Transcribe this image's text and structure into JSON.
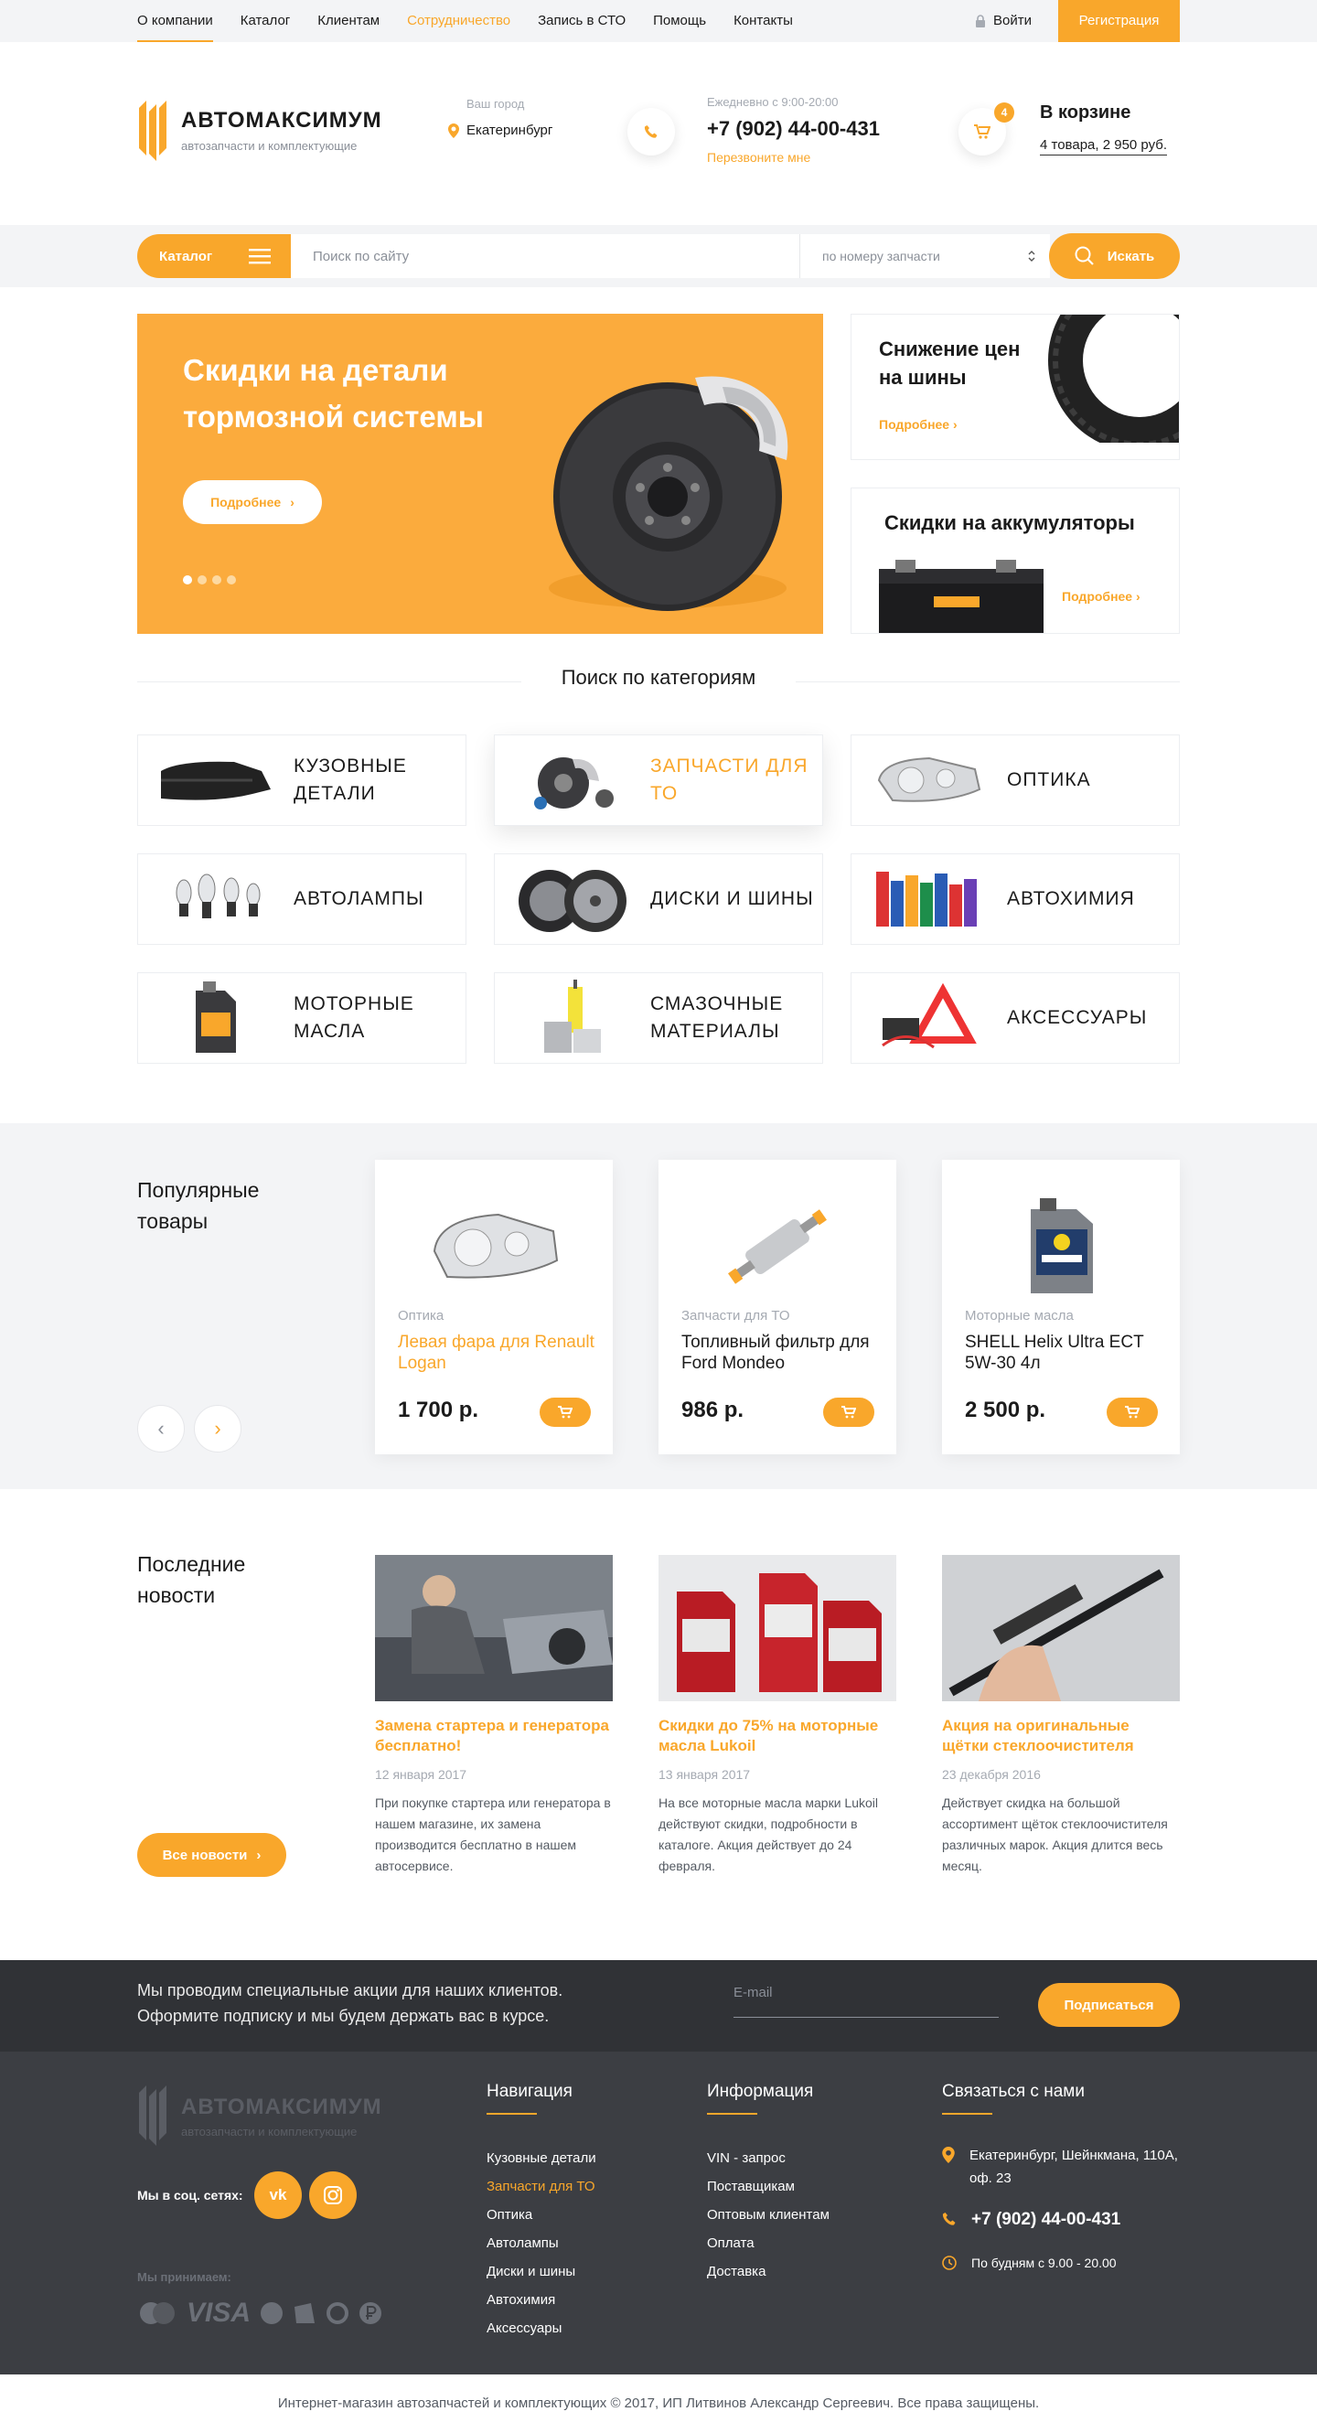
{
  "topnav": {
    "items": [
      "О компании",
      "Каталог",
      "Клиентам",
      "Сотрудничество",
      "Запись в СТО",
      "Помощь",
      "Контакты"
    ],
    "login": "Войти",
    "register": "Регистрация"
  },
  "header": {
    "logo_title": "АВТОМАКСИМУМ",
    "logo_sub": "автозапчасти и комплектующие",
    "city_label": "Ваш город",
    "city": "Екатеринбург",
    "schedule": "Ежедневно с 9:00-20:00",
    "phone": "+7 (902) 44-00-431",
    "callback": "Перезвоните мне",
    "cart_count": "4",
    "cart_title": "В корзине",
    "cart_summary": "4 товара, 2 950 руб."
  },
  "search": {
    "catalog_label": "Каталог",
    "placeholder": "Поиск по сайту",
    "mode": "по номеру запчасти",
    "button": "Искать"
  },
  "hero": {
    "title": "Скидки на детали тормозной системы",
    "button": "Подробнее"
  },
  "promos": [
    {
      "title": "Снижение цен на шины",
      "link": "Подробнее"
    },
    {
      "title": "Скидки на аккумуляторы",
      "link": "Подробнее"
    }
  ],
  "categories_title": "Поиск по категориям",
  "categories": [
    "Кузовные детали",
    "Запчасти для ТО",
    "Оптика",
    "Автолампы",
    "Диски и шины",
    "Автохимия",
    "Моторные масла",
    "Смазочные материалы",
    "Аксессуары"
  ],
  "popular": {
    "title": "Популярные товары",
    "products": [
      {
        "category": "Оптика",
        "name": "Левая фара для Renault Logan",
        "price": "1 700 р."
      },
      {
        "category": "Запчасти для ТО",
        "name": "Топливный фильтр для Ford Mondeo",
        "price": "986 р."
      },
      {
        "category": "Моторные масла",
        "name": "SHELL Helix Ultra ECT 5W-30 4л",
        "price": "2 500 р."
      }
    ]
  },
  "news": {
    "title": "Последние новости",
    "all_button": "Все новости",
    "items": [
      {
        "title": "Замена стартера и генератора бесплатно!",
        "date": "12 января 2017",
        "text": "При покупке стартера или генератора в нашем магазине, их замена производится бесплатно в нашем автосервисе."
      },
      {
        "title": "Скидки до 75% на моторные масла Lukoil",
        "date": "13 января 2017",
        "text": "На все моторные масла марки Lukoil действуют скидки, подробности в каталоге. Акция действует до 24 февраля."
      },
      {
        "title": "Акция на оригинальные щётки стеклоочистителя",
        "date": "23 декабря 2016",
        "text": "Действует скидка на большой ассортимент щёток стеклоочистителя различных марок. Акция длится весь месяц."
      }
    ]
  },
  "subscribe": {
    "text": "Мы проводим специальные акции для наших клиентов. Оформите подписку и мы будем держать вас в курсе.",
    "placeholder": "E-mail",
    "button": "Подписаться"
  },
  "footer": {
    "logo_title": "АВТОМАКСИМУМ",
    "logo_sub": "автозапчасти и комплектующие",
    "social_label": "Мы в соц. сетях:",
    "pay_label": "Мы принимаем:",
    "pay_visa": "VISA",
    "nav_title": "Навигация",
    "nav": [
      "Кузовные детали",
      "Запчасти для ТО",
      "Оптика",
      "Автолампы",
      "Диски и шины",
      "Автохимия",
      "Аксессуары"
    ],
    "info_title": "Информация",
    "info": [
      "VIN - запрос",
      "Поставщикам",
      "Оптовым клиентам",
      "Оплата",
      "Доставка"
    ],
    "contact_title": "Связаться с нами",
    "address": "Екатеринбург, Шейнкмана, 110А, оф. 23",
    "phone": "+7 (902) 44-00-431",
    "hours": "По будням с 9.00 - 20.00",
    "copyright": "Интернет-магазин автозапчастей и комплектующих © 2017, ИП Литвинов Александр Сергеевич. Все права защищены."
  },
  "colors": {
    "accent": "#f9a72b",
    "dark": "#3c3e43",
    "light_bg": "#f3f4f6"
  }
}
